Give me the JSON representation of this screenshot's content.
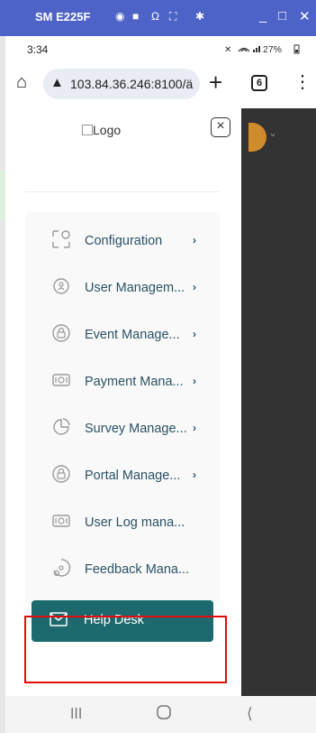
{
  "window": {
    "title": "SM E225F",
    "toolbar_icons": [
      "camera-icon",
      "video-icon",
      "headphones-icon",
      "fullscreen-icon",
      "settings-icon"
    ],
    "controls": [
      "minimize-icon",
      "maximize-icon",
      "close-icon"
    ]
  },
  "status_bar": {
    "time": "3:34",
    "indicators": "ℵ ≘.∥ 27%▮"
  },
  "browser": {
    "url": "103.84.36.246:8100/ä",
    "tab_count": "6"
  },
  "drawer": {
    "logo_alt": "Logo",
    "close_symbol": "×",
    "menu": [
      {
        "label": "Configuration",
        "icon": "config-icon",
        "chevron": "›"
      },
      {
        "label": "User Managem...",
        "icon": "user-shield-icon",
        "chevron": "›"
      },
      {
        "label": "Event Manage...",
        "icon": "lock-icon",
        "chevron": "›"
      },
      {
        "label": "Payment Mana...",
        "icon": "payment-icon",
        "chevron": "›"
      },
      {
        "label": "Survey Manage...",
        "icon": "pie-icon",
        "chevron": "›"
      },
      {
        "label": "Portal Manage...",
        "icon": "lock-icon",
        "chevron": "›"
      },
      {
        "label": "User Log mana...",
        "icon": "payment-icon",
        "chevron": ""
      },
      {
        "label": "Feedback Mana...",
        "icon": "feedback-icon",
        "chevron": ""
      }
    ],
    "help_desk": "Help Desk"
  },
  "colors": {
    "titlebar": "#4e63c7",
    "menu_text": "#2c5266",
    "help_desk_bg": "#1c6a6e",
    "highlight_box": "#e30d0d"
  }
}
